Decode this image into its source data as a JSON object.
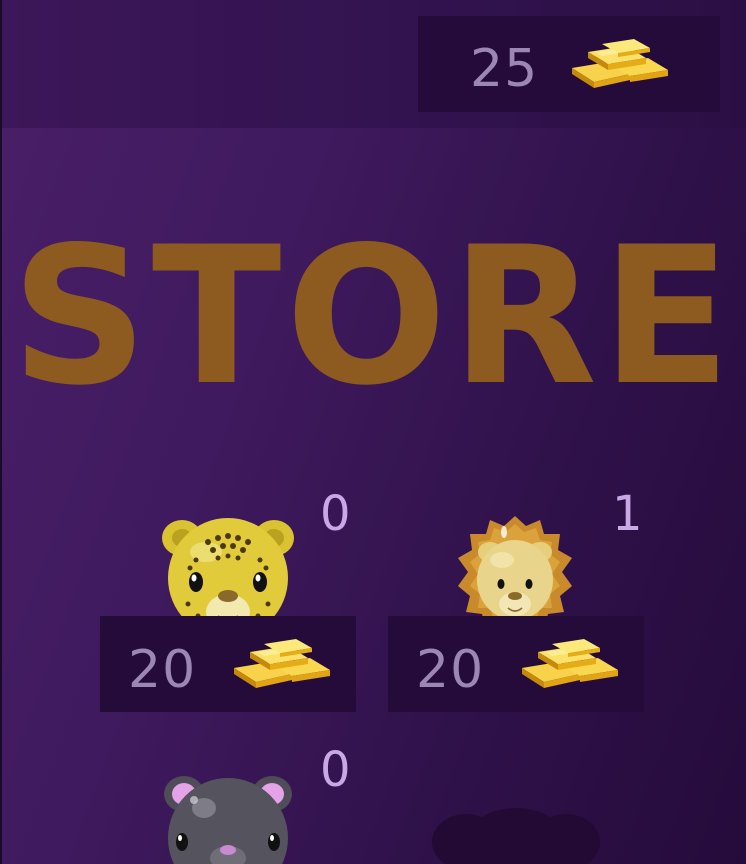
{
  "balance": {
    "amount": "25",
    "icon": "gold-bars-icon"
  },
  "title": "STORE",
  "items": [
    {
      "name": "leopard",
      "owned": "0",
      "price": "20",
      "icon": "leopard-face-icon"
    },
    {
      "name": "lion",
      "owned": "1",
      "price": "20",
      "icon": "lion-face-icon"
    },
    {
      "name": "panther",
      "owned": "0",
      "icon": "panther-face-icon"
    },
    {
      "name": "locked",
      "icon": "locked-silhouette-icon"
    }
  ],
  "colors": {
    "title": "#8d5a1f",
    "panel": "#250b3a",
    "gold": "#f2c11c",
    "count": "#c9a8e6"
  }
}
